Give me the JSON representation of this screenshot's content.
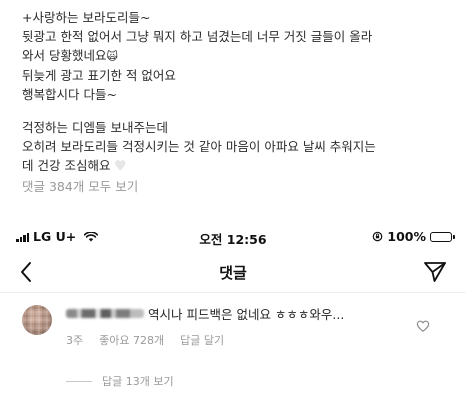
{
  "caption": {
    "lines": [
      "+사랑하는 보라도리들~",
      "뒷광고 한적 없어서 그냥 뭐지 하고 넘겼는데 너무 거짓 글들이 올라",
      "와서 당황했네요",
      "뒤늦게 광고 표기한 적 없어요",
      "행복합시다 다들~",
      "걱정하는 디엠들 보내주는데",
      "오히려 보라도리들 걱정시키는 것 같아 마음이 아파요 날씨 추워지는",
      "데 건강 조심해요"
    ],
    "emoji_surprised": "🙀",
    "view_all_comments": "댓글 384개 모두 보기"
  },
  "status_bar": {
    "carrier": "LG U+",
    "time": "오전 12:56",
    "battery": "100%",
    "battery_level": 1.0
  },
  "nav": {
    "title": "댓글"
  },
  "comment": {
    "text": "역시나 피드백은 없네요 ㅎㅎㅎ와우...",
    "time_ago": "3주",
    "likes": "좋아요 728개",
    "reply": "답글 달기",
    "view_replies": "답글 13개 보기"
  },
  "icons": {
    "back": "chevron-left-icon",
    "send": "paper-plane-icon",
    "like": "heart-outline-icon",
    "wifi": "wifi-icon",
    "signal": "signal-bars-icon",
    "rotation_lock": "rotation-lock-icon",
    "battery": "battery-icon"
  }
}
